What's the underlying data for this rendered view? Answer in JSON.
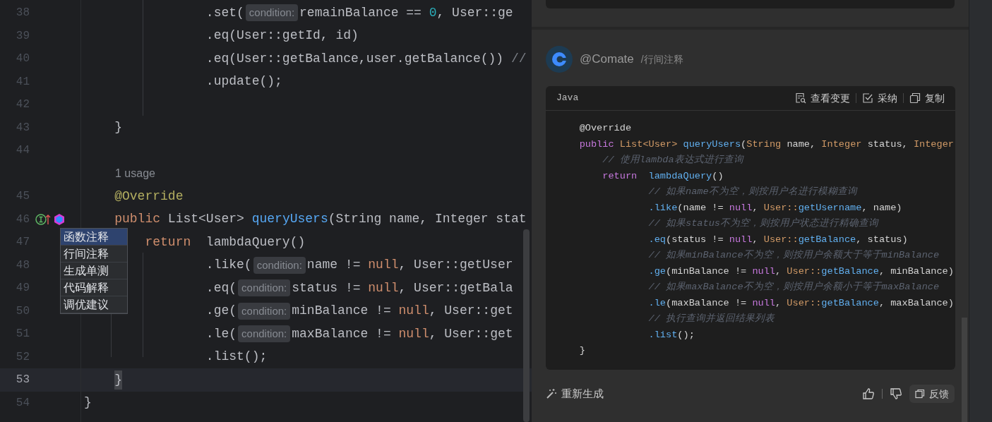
{
  "editor": {
    "lines": [
      {
        "kind": "code",
        "number": "38",
        "current": false,
        "tokens": [
          {
            "text": "                .set(",
            "kind": "plain"
          },
          {
            "text": "condition:",
            "kind": "hint"
          },
          {
            "text": "remainBalance == ",
            "kind": "plain"
          },
          {
            "text": "0",
            "kind": "number"
          },
          {
            "text": ", User::ge",
            "kind": "plain"
          }
        ]
      },
      {
        "kind": "code",
        "number": "39",
        "current": false,
        "tokens": [
          {
            "text": "                .eq(User::getId, id)",
            "kind": "plain"
          }
        ]
      },
      {
        "kind": "code",
        "number": "40",
        "current": false,
        "tokens": [
          {
            "text": "                .eq(User::getBalance,user.getBalance()) ",
            "kind": "plain"
          },
          {
            "text": "//",
            "kind": "comment"
          }
        ]
      },
      {
        "kind": "code",
        "number": "41",
        "current": false,
        "tokens": [
          {
            "text": "                .update();",
            "kind": "plain"
          }
        ]
      },
      {
        "kind": "code",
        "number": "42",
        "current": false
      },
      {
        "kind": "code",
        "number": "43",
        "current": false,
        "tokens": [
          {
            "text": "    }",
            "kind": "plain"
          }
        ]
      },
      {
        "kind": "code",
        "number": "44",
        "current": false
      },
      {
        "kind": "usage",
        "text": "1 usage"
      },
      {
        "kind": "code",
        "number": "45",
        "current": false,
        "tokens": [
          {
            "text": "    @Override",
            "kind": "annotation"
          }
        ]
      },
      {
        "kind": "code",
        "number": "46",
        "current": false,
        "gutter": [
          {
            "kind": "implements"
          },
          {
            "kind": "comate"
          }
        ],
        "tokens": [
          {
            "text": "    public",
            "kind": "keyword"
          },
          {
            "text": " List<User> ",
            "kind": "plain"
          },
          {
            "text": "queryUsers",
            "kind": "function"
          },
          {
            "text": "(String name, Integer stat",
            "kind": "plain"
          }
        ]
      },
      {
        "kind": "code",
        "number": "47",
        "current": false,
        "tokens": [
          {
            "text": "        return",
            "kind": "keyword"
          },
          {
            "text": "  lambdaQuery()",
            "kind": "plain"
          }
        ]
      },
      {
        "kind": "code",
        "number": "48",
        "current": false,
        "tokens": [
          {
            "text": "                .like(",
            "kind": "plain"
          },
          {
            "text": "condition:",
            "kind": "hint"
          },
          {
            "text": "name != ",
            "kind": "plain"
          },
          {
            "text": "null",
            "kind": "keyword"
          },
          {
            "text": ", User::getUser",
            "kind": "plain"
          }
        ]
      },
      {
        "kind": "code",
        "number": "49",
        "current": false,
        "tokens": [
          {
            "text": "                .eq(",
            "kind": "plain"
          },
          {
            "text": "condition:",
            "kind": "hint"
          },
          {
            "text": "status != ",
            "kind": "plain"
          },
          {
            "text": "null",
            "kind": "keyword"
          },
          {
            "text": ", User::getBala",
            "kind": "plain"
          }
        ]
      },
      {
        "kind": "code",
        "number": "50",
        "current": false,
        "tokens": [
          {
            "text": "                .ge(",
            "kind": "plain"
          },
          {
            "text": "condition:",
            "kind": "hint"
          },
          {
            "text": "minBalance != ",
            "kind": "plain"
          },
          {
            "text": "null",
            "kind": "keyword"
          },
          {
            "text": ", User::get",
            "kind": "plain"
          }
        ]
      },
      {
        "kind": "code",
        "number": "51",
        "current": false,
        "tokens": [
          {
            "text": "                .le(",
            "kind": "plain"
          },
          {
            "text": "condition:",
            "kind": "hint"
          },
          {
            "text": "maxBalance != ",
            "kind": "plain"
          },
          {
            "text": "null",
            "kind": "keyword"
          },
          {
            "text": ", User::get",
            "kind": "plain"
          }
        ]
      },
      {
        "kind": "code",
        "number": "52",
        "current": false,
        "tokens": [
          {
            "text": "                .list();",
            "kind": "plain"
          }
        ]
      },
      {
        "kind": "code",
        "number": "53",
        "current": true,
        "tokens": [
          {
            "text": "    }",
            "kind": "brace_match"
          }
        ]
      },
      {
        "kind": "code",
        "number": "54",
        "current": false,
        "tokens": [
          {
            "text": "}",
            "kind": "plain"
          }
        ]
      }
    ]
  },
  "popup_menu": {
    "items": [
      {
        "label": "函数注释",
        "selected": true
      },
      {
        "label": "行间注释",
        "selected": false
      },
      {
        "label": "生成单测",
        "selected": false
      },
      {
        "label": "代码解释",
        "selected": false
      },
      {
        "label": "调优建议",
        "selected": false
      }
    ]
  },
  "chat": {
    "author": "@Comate",
    "command": "/行间注释",
    "code_block": {
      "language": "Java",
      "actions": [
        {
          "label": "查看变更",
          "kind": "diff"
        },
        {
          "label": "采纳",
          "kind": "accept"
        },
        {
          "label": "复制",
          "kind": "copy"
        }
      ],
      "lines": [
        [
          {
            "text": "    @Override",
            "kind": "plain"
          }
        ],
        [
          {
            "text": "    public",
            "kind": "keyword"
          },
          {
            "text": " List<User>",
            "kind": "type"
          },
          {
            "text": " queryUsers",
            "kind": "function"
          },
          {
            "text": "(",
            "kind": "plain"
          },
          {
            "text": "String",
            "kind": "type"
          },
          {
            "text": " name, ",
            "kind": "plain"
          },
          {
            "text": "Integer",
            "kind": "type"
          },
          {
            "text": " status, ",
            "kind": "plain"
          },
          {
            "text": "Integer",
            "kind": "type"
          }
        ],
        [
          {
            "text": "        // 使用lambda表达式进行查询",
            "kind": "comment"
          }
        ],
        [
          {
            "text": "        return",
            "kind": "keyword"
          },
          {
            "text": "  lambdaQuery",
            "kind": "function"
          },
          {
            "text": "()",
            "kind": "plain"
          }
        ],
        [
          {
            "text": "                // 如果name不为空，则按用户名进行模糊查询",
            "kind": "comment"
          }
        ],
        [
          {
            "text": "                .like",
            "kind": "function"
          },
          {
            "text": "(name != ",
            "kind": "plain"
          },
          {
            "text": "null",
            "kind": "keyword"
          },
          {
            "text": ", ",
            "kind": "plain"
          },
          {
            "text": "User::",
            "kind": "type"
          },
          {
            "text": "getUsername",
            "kind": "function"
          },
          {
            "text": ", name)",
            "kind": "plain"
          }
        ],
        [
          {
            "text": "                // 如果status不为空，则按用户状态进行精确查询",
            "kind": "comment"
          }
        ],
        [
          {
            "text": "                .eq",
            "kind": "function"
          },
          {
            "text": "(status != ",
            "kind": "plain"
          },
          {
            "text": "null",
            "kind": "keyword"
          },
          {
            "text": ", ",
            "kind": "plain"
          },
          {
            "text": "User::",
            "kind": "type"
          },
          {
            "text": "getBalance",
            "kind": "function"
          },
          {
            "text": ", status)",
            "kind": "plain"
          }
        ],
        [
          {
            "text": "                // 如果minBalance不为空，则按用户余额大于等于minBalance",
            "kind": "comment"
          }
        ],
        [
          {
            "text": "                .ge",
            "kind": "function"
          },
          {
            "text": "(minBalance != ",
            "kind": "plain"
          },
          {
            "text": "null",
            "kind": "keyword"
          },
          {
            "text": ", ",
            "kind": "plain"
          },
          {
            "text": "User::",
            "kind": "type"
          },
          {
            "text": "getBalance",
            "kind": "function"
          },
          {
            "text": ", minBalance)",
            "kind": "plain"
          }
        ],
        [
          {
            "text": "                // 如果maxBalance不为空，则按用户余额小于等于maxBalance",
            "kind": "comment"
          }
        ],
        [
          {
            "text": "                .le",
            "kind": "function"
          },
          {
            "text": "(maxBalance != ",
            "kind": "plain"
          },
          {
            "text": "null",
            "kind": "keyword"
          },
          {
            "text": ", ",
            "kind": "plain"
          },
          {
            "text": "User::",
            "kind": "type"
          },
          {
            "text": "getBalance",
            "kind": "function"
          },
          {
            "text": ", maxBalance)",
            "kind": "plain"
          }
        ],
        [
          {
            "text": "                // 执行查询并返回结果列表",
            "kind": "comment"
          }
        ],
        [
          {
            "text": "                .list",
            "kind": "function"
          },
          {
            "text": "();",
            "kind": "plain"
          }
        ],
        [
          {
            "text": "    }",
            "kind": "plain"
          }
        ]
      ]
    },
    "regenerate": "重新生成",
    "feedback": "反馈"
  }
}
